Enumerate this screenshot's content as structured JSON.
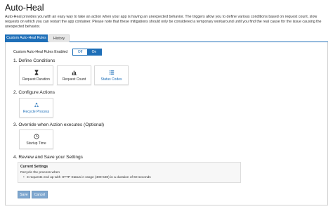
{
  "page": {
    "title": "Auto-Heal",
    "intro": "Auto-Heal provides you with an easy way to take an action when your app is having an unexpected behavior. The triggers allow you to define various conditions based on request count, slow requests on which you can restart the app container. Please note that these mitigations should only be considered a temporary workaround until you find the real cause for the issue causing the unexpected behavior."
  },
  "tabs": [
    {
      "label": "Custom Auto-Heal Rules",
      "active": true
    },
    {
      "label": "History",
      "active": false
    }
  ],
  "toggle": {
    "label": "Custom Auto-Heal Rules Enabled",
    "off_label": "Off",
    "on_label": "On",
    "value": "On"
  },
  "sections": {
    "conditions": {
      "heading": "1. Define Conditions",
      "cards": [
        {
          "label": "Request Duration",
          "icon": "hourglass-icon",
          "selected": false
        },
        {
          "label": "Request Count",
          "icon": "bar-chart-icon",
          "selected": false
        },
        {
          "label": "Status Codes",
          "icon": "list-icon",
          "selected": true
        }
      ]
    },
    "actions": {
      "heading": "2. Configure Actions",
      "cards": [
        {
          "label": "Recycle Process",
          "icon": "recycle-icon",
          "selected": true
        }
      ]
    },
    "override": {
      "heading": "3. Override when Action executes (Optional)",
      "cards": [
        {
          "label": "Startup Time",
          "icon": "clock-icon",
          "selected": false
        }
      ]
    },
    "review": {
      "heading": "4. Review and Save your Settings",
      "box_title": "Current Settings",
      "summary": "Recycle the process when",
      "bullet": "3 requests end up with HTTP Status in range (400-530) in a duration of 60 seconds"
    }
  },
  "buttons": {
    "save_label": "Save",
    "cancel_label": "Cancel"
  },
  "colors": {
    "accent": "#1e6fb8",
    "disabled_button": "#7fa7cf"
  }
}
